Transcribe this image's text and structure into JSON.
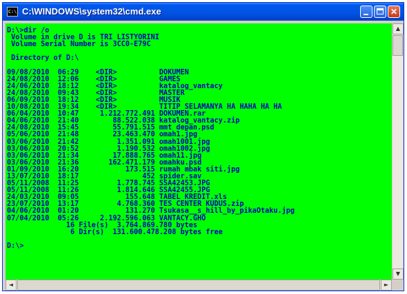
{
  "window": {
    "title": "C:\\WINDOWS\\system32\\cmd.exe",
    "icon": "C:\\"
  },
  "console": {
    "lines": [
      "D:\\>dir /o",
      " Volume in drive D is TRI LISTYORINI",
      " Volume Serial Number is 3CC0-E79C",
      "",
      " Directory of D:\\",
      "",
      "09/08/2010  06:29    <DIR>          DOKUMEN",
      "24/08/2010  12:06    <DIR>          GAMES",
      "24/06/2010  18:12    <DIR>          katalog_vantacy",
      "24/08/2010  09:43    <DIR>          MASTER",
      "06/09/2010  18:12    <DIR>          MUSIK",
      "10/08/2010  19:34    <DIR>          TITIP SELAMANYA HA HAHA HA HA",
      "06/04/2010  10:47     1.212.772.491 DOKUMEN.rar",
      "04/06/2010  21:40        88.522.038 katalog_vantacy.zip",
      "24/08/2010  15:45        55.791.515 mmt depan.psd",
      "05/06/2010  21:48        23.463.470 omah1.jpg",
      "03/06/2010  21:42         1.351.091 omah1001.jpg",
      "03/06/2010  20:52         1.190.532 omah1002.jpg",
      "03/06/2010  21:34        17.888.765 omah11.jpg",
      "03/06/2010  21:36       162.471.179 omahku.psd",
      "01/09/2010  16:20           173.515 rumah mbak siti.jpg",
      "13/07/2010  18:17               452 spider.sav",
      "05/11/2008  11:25         1.778.745 SSA42453.JPG",
      "05/11/2008  11:26         1.814.646 SSA42455.JPG",
      "24/03/2010  09:05           155.648 TABEL KREDIT.xls",
      "23/07/2010  13:17         4.768.360 TES CENTER KUDUS.zip",
      "04/06/2010  01:20           131.270 Tsukasa__s_hill_by_pikaOtaku.jpg",
      "07/04/2010  05:26     2.192.596.063 VANTACY.GHO",
      "              16 File(s)  3.764.869.780 bytes",
      "               6 Dir(s)  131.600.478.208 bytes free",
      "",
      "D:\\>"
    ]
  },
  "scrollbars": {
    "up_arrow": "▲",
    "down_arrow": "▼",
    "left_arrow": "◄",
    "right_arrow": "►"
  },
  "colors": {
    "console_bg": "#00ff00",
    "console_fg": "#0000c0",
    "titlebar": "#0054e3"
  }
}
